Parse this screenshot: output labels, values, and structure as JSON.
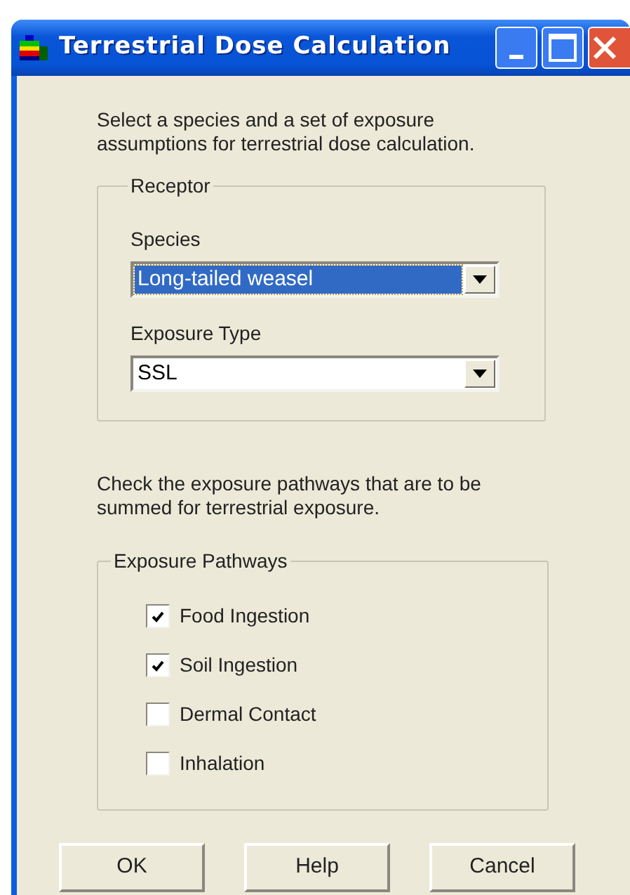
{
  "window": {
    "title": "Terrestrial Dose Calculation"
  },
  "intro": "Select a species and a set of exposure assumptions for terrestrial dose calculation.",
  "receptor": {
    "title": "Receptor",
    "fields": [
      {
        "label": "Species",
        "value": "Long-tailed weasel",
        "selected": true
      },
      {
        "label": "Exposure Type",
        "value": "SSL",
        "selected": false
      }
    ]
  },
  "pathways_note": "Check the exposure pathways that are to be summed for terrestrial exposure.",
  "pathways": {
    "title": "Exposure Pathways",
    "items": [
      {
        "label": "Food Ingestion",
        "checked": true
      },
      {
        "label": "Soil Ingestion",
        "checked": true
      },
      {
        "label": "Dermal Contact",
        "checked": false
      },
      {
        "label": "Inhalation",
        "checked": false
      }
    ]
  },
  "buttons": [
    "OK",
    "Help",
    "Cancel"
  ]
}
